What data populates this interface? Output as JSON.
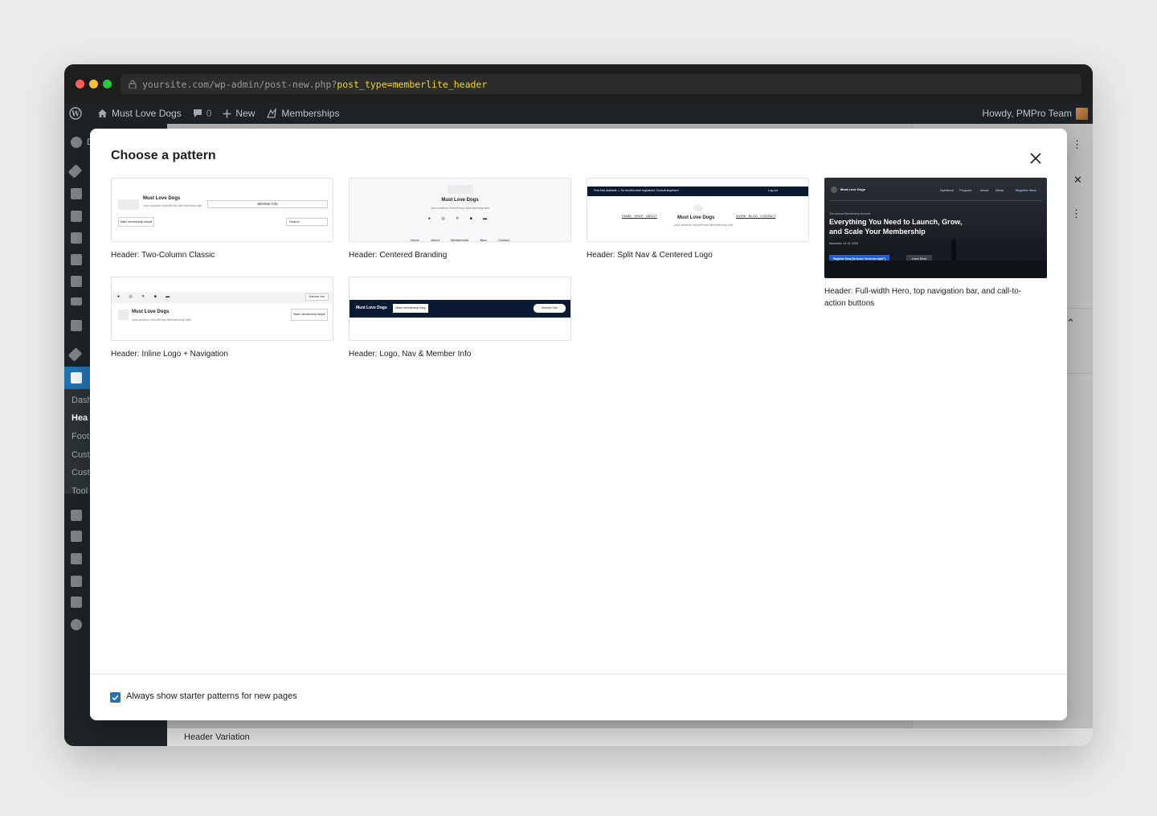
{
  "browser": {
    "url_base": "yoursite.com/wp-admin/post-new.php?",
    "url_query": "post_type=memberlite_header"
  },
  "admin_bar": {
    "site_name": "Must Love Dogs",
    "comments_count": "0",
    "new_label": "New",
    "memberships_label": "Memberships",
    "howdy": "Howdy, PMPro Team"
  },
  "sidebar": {
    "submenu": [
      {
        "label": "Dash",
        "active": false
      },
      {
        "label": "Hea",
        "active": true
      },
      {
        "label": "Foot",
        "active": false
      },
      {
        "label": "Cust",
        "active": false
      },
      {
        "label": "Cust",
        "active": false
      },
      {
        "label": "Tool",
        "active": false
      }
    ],
    "partial_first": "D"
  },
  "editor": {
    "footer_label": "Header Variation"
  },
  "modal": {
    "title": "Choose a pattern",
    "checkbox_label": "Always show starter patterns for new pages",
    "checkbox_checked": true,
    "patterns": [
      {
        "label": "Header: Two-Column Classic",
        "preview": {
          "site_title": "Must Love Dogs",
          "tagline": "Just another WordPress Membership site",
          "member_info": "Member Info",
          "button": "Make membership simple",
          "search": "Search"
        }
      },
      {
        "label": "Header: Centered Branding",
        "preview": {
          "site_title": "Must Love Dogs",
          "tagline": "Just another WordPress Membership site",
          "nav": [
            "Home",
            "About",
            "Membership",
            "Blog",
            "Contact"
          ]
        }
      },
      {
        "label": "Header: Split Nav & Centered Logo",
        "preview": {
          "banner_text": "Free trial available — for months each registered. Consult anywhere",
          "login": "Log out",
          "site_title": "Must Love Dogs",
          "tagline": "Just another WordPress Membership site",
          "nav_left": [
            "HOME",
            "SHOP",
            "ABOUT"
          ],
          "nav_right": [
            "WORK",
            "BLOG",
            "CONTACT"
          ]
        }
      },
      {
        "label": "Header: Full-width Hero, top navigation bar, and call-to-action buttons",
        "preview": {
          "site_title": "Must Love Dogs",
          "nav": [
            "Speakers",
            "Program",
            "About",
            "News"
          ],
          "cta": "Register Now",
          "eyebrow": "The Annual Membership Summit",
          "headline_line1": "Everything You Need to Launch, Grow,",
          "headline_line2": "and Scale Your Membership",
          "date": "November 13-14, 2026",
          "primary_button": "Register Now [fa icon=\"chevron-right\"]",
          "secondary_button": "Learn More"
        }
      },
      {
        "label": "Header: Inline Logo + Navigation",
        "preview": {
          "member_info": "Member Info",
          "site_title": "Must Love Dogs",
          "tagline": "Just another WordPress Membership site",
          "button": "Make membership simple"
        }
      },
      {
        "label": "Header: Logo, Nav & Member Info",
        "preview": {
          "site_title": "Must Love Dogs",
          "button": "Make membership easy",
          "member_info": "Member Info"
        }
      }
    ]
  },
  "colors": {
    "accent": "#2271b1",
    "admin_bar": "#1d2327",
    "navy": "#0b1a33",
    "url_highlight": "#f5d90a"
  }
}
